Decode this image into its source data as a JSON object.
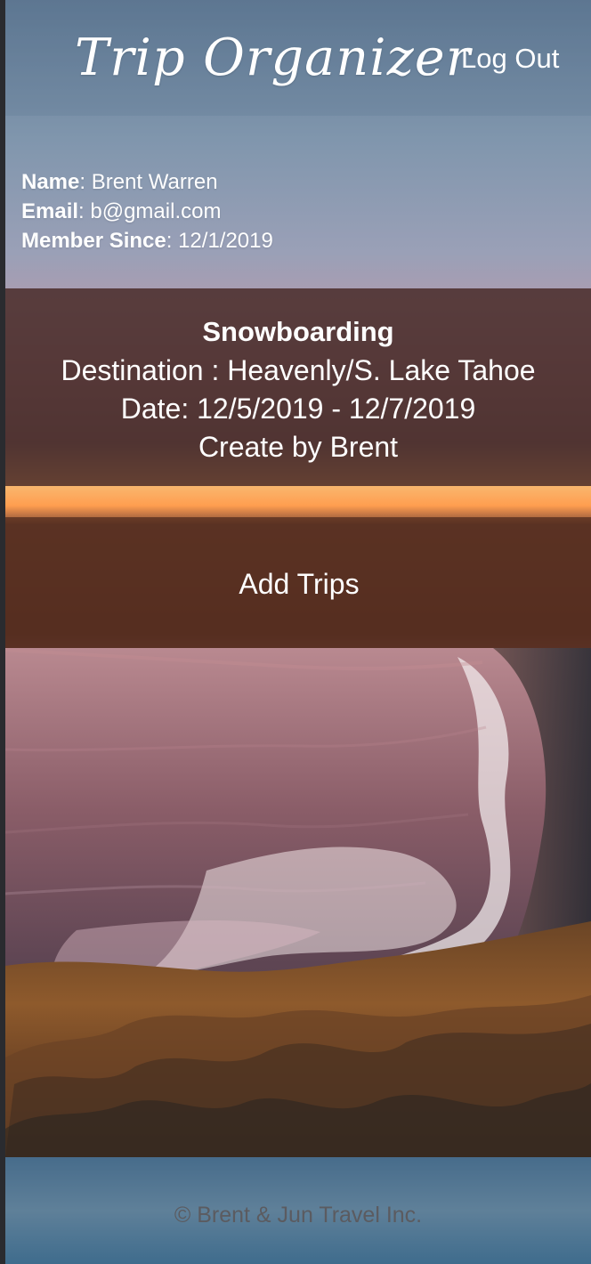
{
  "app": {
    "title": "Trip Organizer",
    "logout_label": "Log Out"
  },
  "profile": {
    "name_label": "Name",
    "name_value": "Brent Warren",
    "email_label": "Email",
    "email_value": "b@gmail.com",
    "member_since_label": "Member Since",
    "member_since_value": "12/1/2019"
  },
  "trip": {
    "title": "Snowboarding",
    "destination": "Destination : Heavenly/S. Lake Tahoe",
    "date": "Date: 12/5/2019 - 12/7/2019",
    "creator": "Create by Brent"
  },
  "actions": {
    "add_trips_label": "Add Trips"
  },
  "footer": {
    "copyright": "© Brent & Jun Travel Inc."
  },
  "colors": {
    "text": "#ffffff",
    "footer_text": "#5b5b60",
    "trip_overlay": "#482a26",
    "add_overlay": "#4c281b"
  },
  "icons": {
    "background": "coastal-sunset-photo"
  }
}
